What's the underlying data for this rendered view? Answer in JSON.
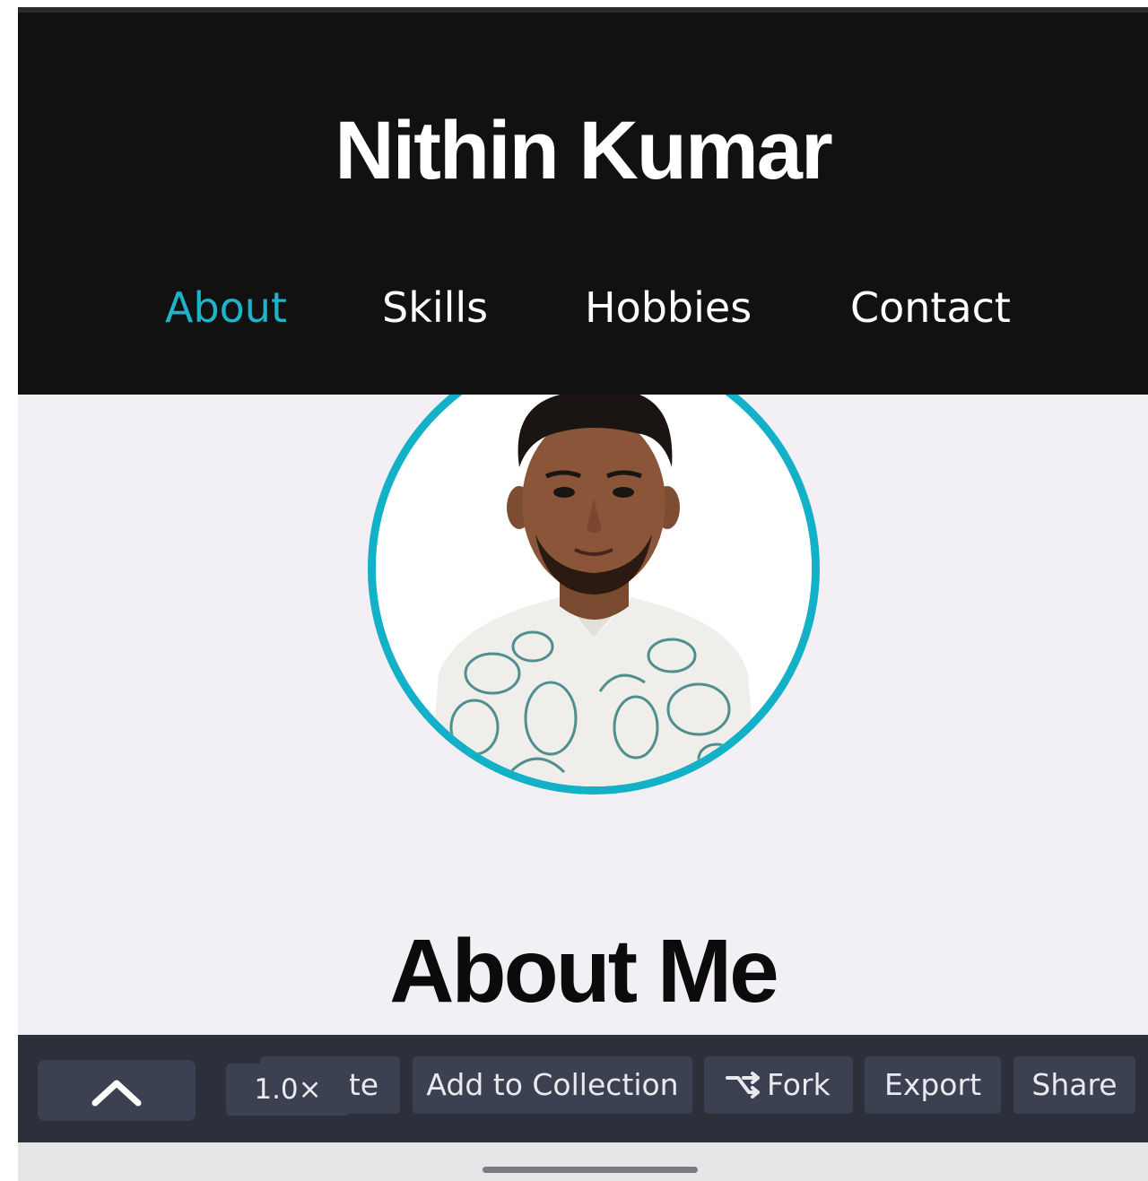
{
  "site": {
    "title": "Nithin Kumar"
  },
  "nav": {
    "items": [
      {
        "label": "About",
        "active": true
      },
      {
        "label": "Skills",
        "active": false
      },
      {
        "label": "Hobbies",
        "active": false
      },
      {
        "label": "Contact",
        "active": false
      }
    ]
  },
  "main": {
    "section_title": "About Me"
  },
  "toolbar": {
    "up_icon": "chevron-up-icon",
    "zoom": "1.0×",
    "partial_label": "te",
    "collection_label": "Add to Collection",
    "fork_label": "Fork",
    "fork_icon": "fork-icon",
    "export_label": "Export",
    "share_label": "Share"
  },
  "colors": {
    "accent": "#13b1c8",
    "header_bg": "#111111",
    "content_bg": "#f2f0f5",
    "toolbar_bg": "#2b303b",
    "toolbar_button": "#3b4150"
  }
}
